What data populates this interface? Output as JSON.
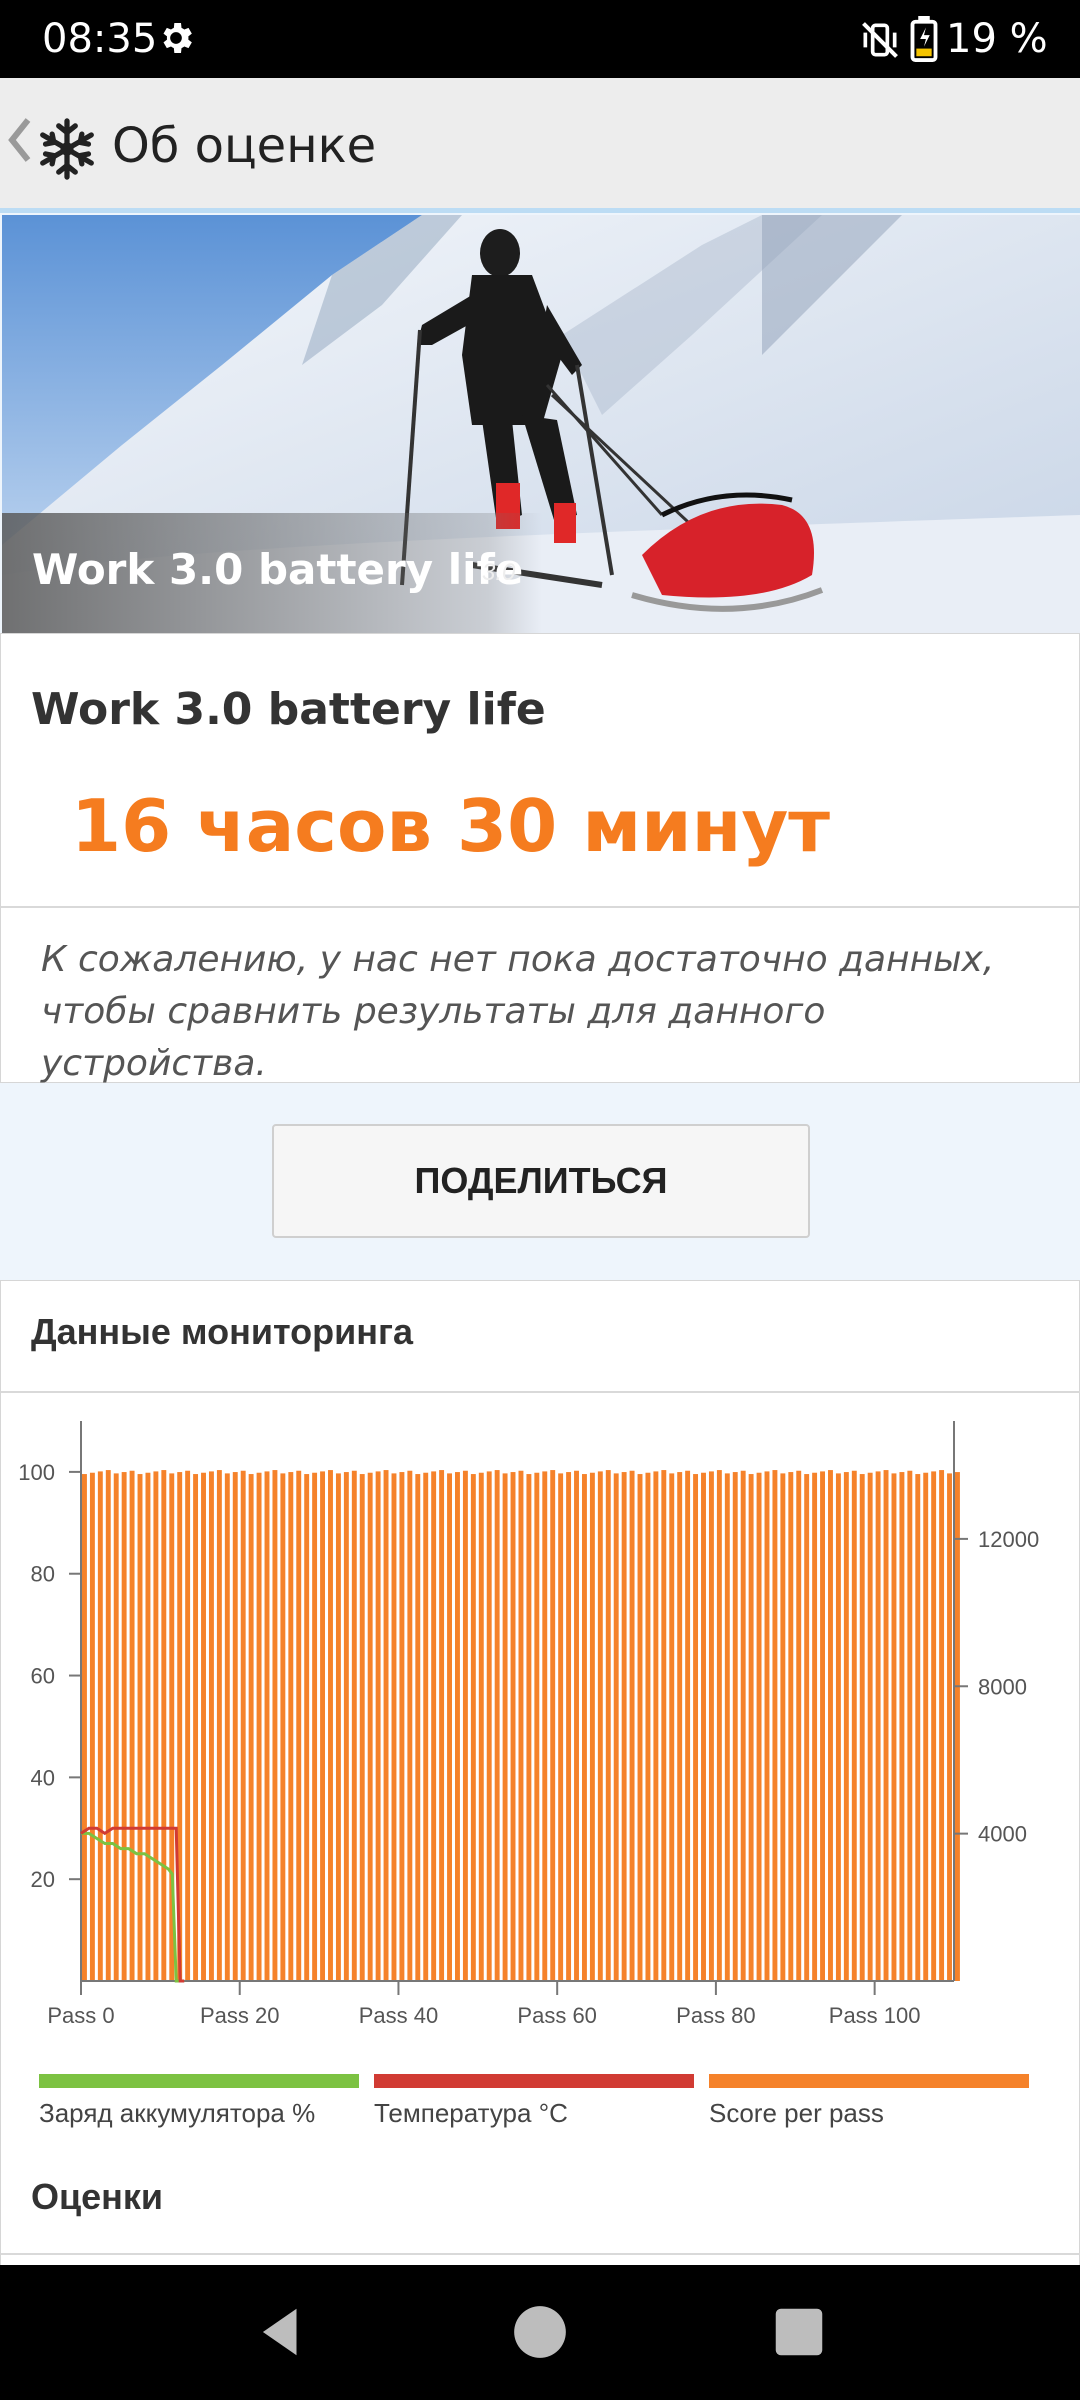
{
  "status_bar": {
    "time": "08:35",
    "battery_percent": "19 %"
  },
  "app_bar": {
    "title": "Об оценке"
  },
  "hero": {
    "title": "Work 3.0 battery life",
    "version": "3.0"
  },
  "result_card": {
    "heading": "Work 3.0 battery life",
    "result": "16 часов 30 минут",
    "message": "К сожалению, у нас нет пока достаточно данных, чтобы сравнить результаты для данного устройства."
  },
  "share_button": {
    "label": "ПОДЕЛИТЬСЯ"
  },
  "monitoring": {
    "heading": "Данные мониторинга",
    "ratings_heading": "Оценки"
  },
  "colors": {
    "accent": "#f57c1f",
    "battery": "#7cc242",
    "temperature": "#d13b33",
    "score": "#f5822a"
  },
  "chart_data": {
    "type": "bar",
    "x_tick_labels": [
      "Pass 0",
      "Pass 20",
      "Pass 40",
      "Pass 60",
      "Pass 80",
      "Pass 100"
    ],
    "x_ticks": [
      0,
      20,
      40,
      60,
      80,
      100
    ],
    "x_range": [
      0,
      110
    ],
    "y_left_ticks": [
      20,
      40,
      60,
      80,
      100
    ],
    "y_left_range": [
      0,
      110
    ],
    "y_right_ticks": [
      4000,
      8000,
      12000
    ],
    "y_right_range": [
      0,
      15200
    ],
    "series": [
      {
        "name": "Заряд аккумулятора %",
        "type": "line",
        "axis": "left",
        "x": [
          0,
          1,
          2,
          3,
          4,
          5,
          6,
          7,
          8,
          9,
          10,
          11,
          11.5,
          12,
          13
        ],
        "values": [
          29,
          29,
          28,
          27,
          27,
          26,
          26,
          25,
          25,
          24,
          23,
          22,
          21,
          0,
          0
        ]
      },
      {
        "name": "Температура °C",
        "type": "line",
        "axis": "left",
        "x": [
          0,
          1,
          2,
          3,
          4,
          5,
          6,
          7,
          8,
          9,
          10,
          11,
          12,
          12.5,
          13
        ],
        "values": [
          29,
          30,
          30,
          29,
          30,
          30,
          30,
          30,
          30,
          30,
          30,
          30,
          30,
          0,
          0
        ]
      },
      {
        "name": "Score per pass",
        "type": "bar",
        "axis": "right",
        "approx_value": 13800,
        "passes": 111
      }
    ]
  }
}
